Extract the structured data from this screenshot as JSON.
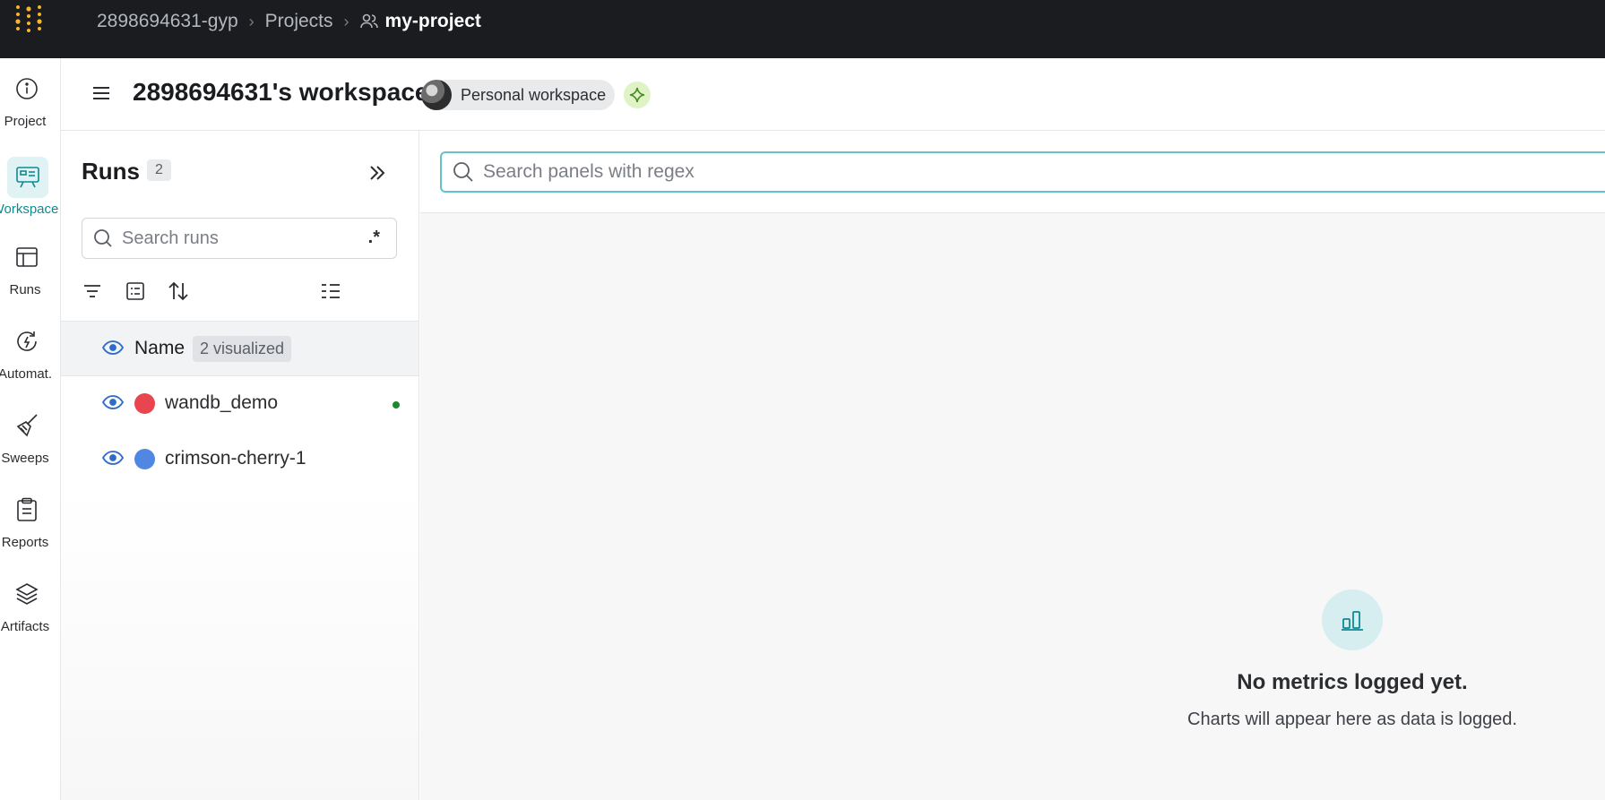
{
  "topbar": {
    "breadcrumbs": [
      "2898694631-gyp",
      "Projects"
    ],
    "current_project": "my-project"
  },
  "leftnav": {
    "items": [
      {
        "label": "Project",
        "icon": "info-icon"
      },
      {
        "label": "Workspace",
        "icon": "workspace-icon",
        "active": true
      },
      {
        "label": "Runs",
        "icon": "runs-table-icon"
      },
      {
        "label": "Automat.",
        "icon": "automations-icon"
      },
      {
        "label": "Sweeps",
        "icon": "broom-icon"
      },
      {
        "label": "Reports",
        "icon": "clipboard-icon"
      },
      {
        "label": "Artifacts",
        "icon": "layers-icon"
      }
    ]
  },
  "workspace": {
    "title": "2898694631's workspace",
    "badge": "Personal workspace"
  },
  "runs_panel": {
    "title": "Runs",
    "count": "2",
    "search_placeholder": "Search runs",
    "regex_label": ".*",
    "name_header": "Name",
    "visualized": "2 visualized",
    "runs": [
      {
        "name": "wandb_demo",
        "color": "#e8454f",
        "live": true
      },
      {
        "name": "crimson-cherry-1",
        "color": "#5087e3",
        "live": false
      }
    ]
  },
  "main": {
    "search_placeholder": "Search panels with regex",
    "empty_title": "No metrics logged yet.",
    "empty_subtitle": "Charts will appear here as data is logged."
  },
  "colors": {
    "accent": "#0f8a94",
    "topbar_bg": "#1a1c1f",
    "logo": "#f5b62e"
  }
}
